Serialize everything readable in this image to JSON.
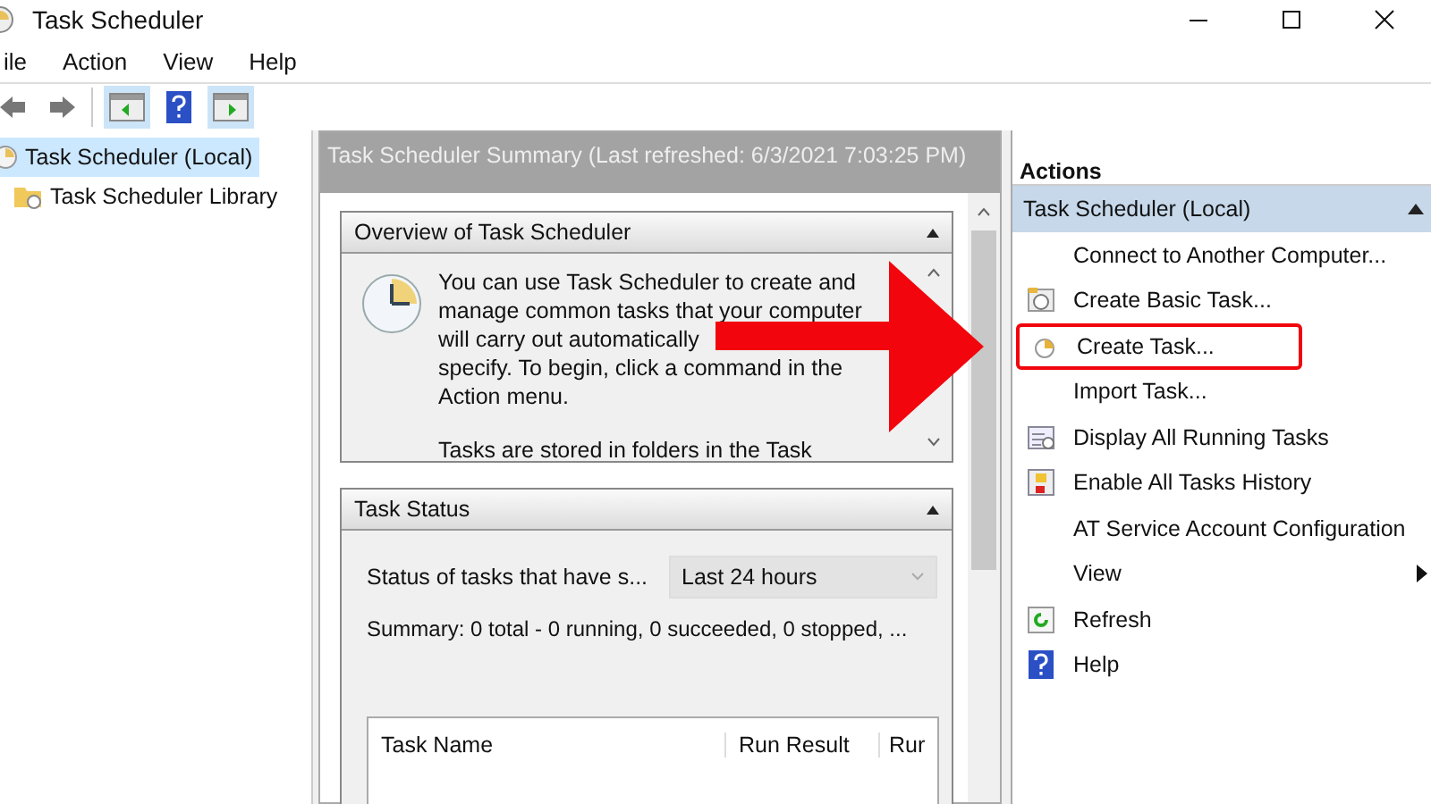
{
  "window": {
    "title": "Task Scheduler"
  },
  "menu": [
    "ile",
    "Action",
    "View",
    "Help"
  ],
  "toolbar": [
    {
      "kind": "back",
      "pressed": false
    },
    {
      "kind": "forward",
      "pressed": false
    },
    {
      "kind": "console-tree",
      "pressed": true
    },
    {
      "kind": "help",
      "pressed": false
    },
    {
      "kind": "action-pane",
      "pressed": true
    }
  ],
  "tree": [
    {
      "label": "Task Scheduler (Local)",
      "selected": true,
      "children": [
        {
          "label": "Task Scheduler Library",
          "selected": false
        }
      ]
    }
  ],
  "summary": {
    "header": "Task Scheduler Summary (Last refreshed: 6/3/2021 7:03:25 PM)",
    "overview": {
      "title": "Overview of Task Scheduler",
      "paragraphs": [
        [
          "You can use Task Scheduler to create and",
          "manage common tasks that your computer",
          "will carry out automatically",
          "specify. To begin, click a command in the",
          "Action menu."
        ],
        [
          "Tasks are stored in folders in the Task"
        ]
      ]
    },
    "status": {
      "title": "Task Status",
      "filter_label": "Status of tasks that have s...",
      "filter_value": "Last 24 hours",
      "summary": "Summary: 0 total - 0 running, 0 succeeded, 0 stopped, ...",
      "columns": [
        "Task Name",
        "Run Result",
        "Rur"
      ]
    }
  },
  "actions": {
    "title": "Actions",
    "group": "Task Scheduler (Local)",
    "items": [
      {
        "label": "Connect to Another Computer...",
        "kind": "command",
        "highlighted": false
      },
      {
        "label": "Create Basic Task...",
        "kind": "command",
        "highlighted": false
      },
      {
        "label": "Create Task...",
        "kind": "command",
        "highlighted": true
      },
      {
        "label": "Import Task...",
        "kind": "command",
        "highlighted": false
      },
      {
        "label": "Display All Running Tasks",
        "kind": "command",
        "highlighted": false
      },
      {
        "label": "Enable All Tasks History",
        "kind": "command",
        "highlighted": false
      },
      {
        "label": "AT Service Account Configuration",
        "kind": "command",
        "highlighted": false
      },
      {
        "label": "View",
        "kind": "submenu",
        "highlighted": false
      },
      {
        "label": "Refresh",
        "kind": "command",
        "highlighted": false
      },
      {
        "label": "Help",
        "kind": "command",
        "highlighted": false
      }
    ]
  }
}
